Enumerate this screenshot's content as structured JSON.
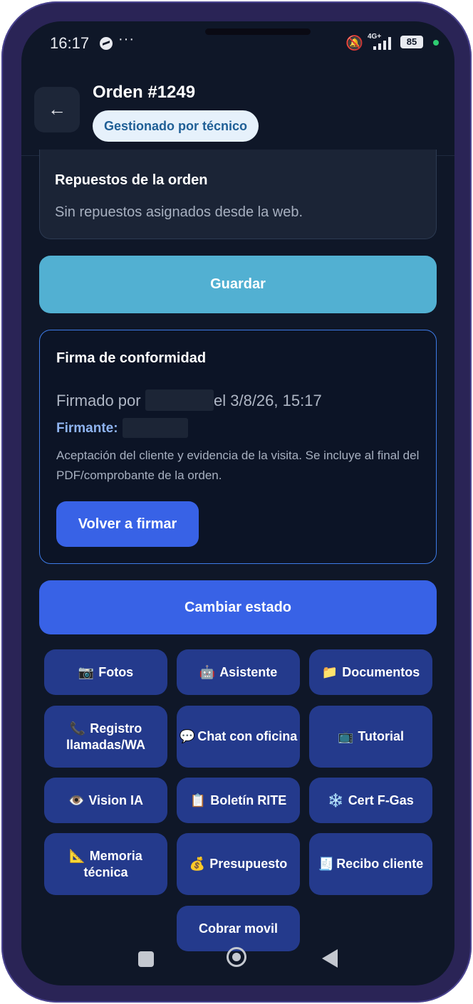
{
  "status_bar": {
    "time": "16:17",
    "dots": "···",
    "network": "4G+",
    "battery": "85"
  },
  "header": {
    "back": "←",
    "title": "Orden #1249",
    "badge": "Gestionado por técnico"
  },
  "repuestos": {
    "title": "Repuestos de la orden",
    "text": "Sin repuestos asignados desde la web."
  },
  "guardar": "Guardar",
  "firma": {
    "title": "Firma de conformidad",
    "firmado_prefix": "Firmado por",
    "firmado_suffix": "el 3/8/26, 15:17",
    "firmante_label": "Firmante:",
    "description": "Aceptación del cliente y evidencia de la visita. Se incluye al final del PDF/comprobante de la orden.",
    "volver": "Volver a firmar"
  },
  "cambiar_estado": "Cambiar estado",
  "actions": [
    {
      "icon": "📷",
      "label": "Fotos"
    },
    {
      "icon": "🤖",
      "label": "Asistente"
    },
    {
      "icon": "📁",
      "label": "Documentos"
    },
    {
      "icon": "📞",
      "label": "Registro llamadas/WA"
    },
    {
      "icon": "💬",
      "label": "Chat con oficina"
    },
    {
      "icon": "📺",
      "label": "Tutorial"
    },
    {
      "icon": "👁️",
      "label": "Vision IA"
    },
    {
      "icon": "📋",
      "label": "Boletín RITE"
    },
    {
      "icon": "❄️",
      "label": "Cert F-Gas"
    },
    {
      "icon": "📐",
      "label": "Memoria técnica"
    },
    {
      "icon": "💰",
      "label": "Presupuesto"
    },
    {
      "icon": "🧾",
      "label": "Recibo cliente"
    },
    {
      "icon": "",
      "label": "Cobrar movil"
    }
  ],
  "colors": {
    "background": "#0f1728",
    "primary": "#3862e6",
    "save": "#52b0d2",
    "grid_button": "#243a8c"
  }
}
